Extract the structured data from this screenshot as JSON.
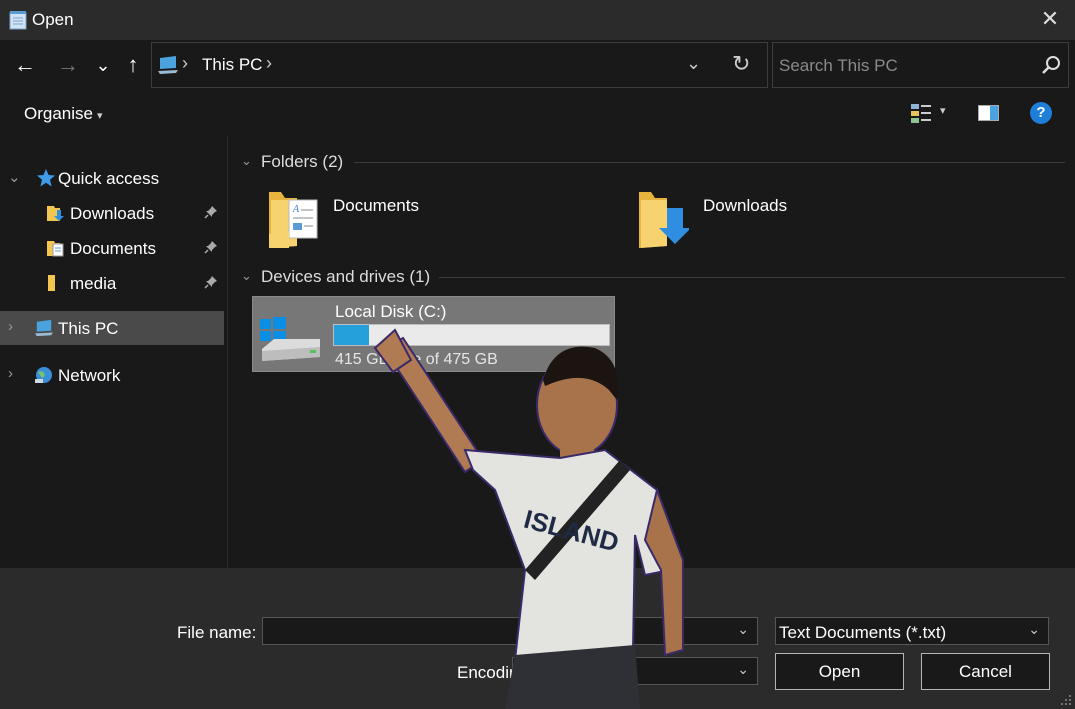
{
  "window": {
    "title": "Open",
    "close_glyph": "✕"
  },
  "nav": {
    "back_glyph": "←",
    "forward_glyph": "→",
    "recent_glyph": "⌄",
    "up_glyph": "↑",
    "breadcrumb": [
      "This PC"
    ],
    "refresh_glyph": "↻",
    "search_placeholder": "Search This PC"
  },
  "toolbar": {
    "organise_label": "Organise",
    "help_glyph": "?"
  },
  "sidebar": {
    "items": [
      {
        "label": "Quick access",
        "icon": "star-icon"
      },
      {
        "label": "Downloads",
        "icon": "downloads-folder-icon",
        "pinned": true
      },
      {
        "label": "Documents",
        "icon": "documents-folder-icon",
        "pinned": true
      },
      {
        "label": "media",
        "icon": "folder-icon",
        "pinned": true
      },
      {
        "label": "This PC",
        "icon": "computer-icon",
        "selected": true
      },
      {
        "label": "Network",
        "icon": "network-icon"
      }
    ]
  },
  "content": {
    "folders_header": "Folders (2)",
    "folders": [
      {
        "name": "Documents",
        "icon": "documents-folder-icon"
      },
      {
        "name": "Downloads",
        "icon": "downloads-folder-icon"
      }
    ],
    "devices_header": "Devices and drives (1)",
    "drive": {
      "name": "Local Disk (C:)",
      "free_text": "415 GB free of 475 GB",
      "used_fraction": 0.126,
      "icon": "hard-drive-icon"
    }
  },
  "footer": {
    "file_name_label": "File name:",
    "file_name_value": "",
    "file_type_value": "Text Documents (*.txt)",
    "encoding_label": "Encoding:",
    "encoding_value": "",
    "open_label": "Open",
    "cancel_label": "Cancel"
  },
  "colors": {
    "background": "#191919",
    "chrome": "#2b2b2b",
    "accent": "#26a0da",
    "selected": "#4a4a4a",
    "folder_yellow": "#f3c64f"
  }
}
